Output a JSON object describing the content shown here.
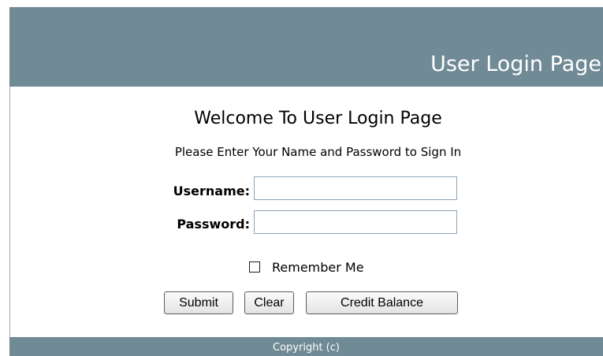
{
  "header": {
    "title": "User Login Page"
  },
  "main": {
    "welcome_heading": "Welcome To User Login Page",
    "instructions": "Please Enter Your Name and Password to Sign In",
    "username": {
      "label": "Username:",
      "value": ""
    },
    "password": {
      "label": "Password:",
      "value": ""
    },
    "remember_me": {
      "label": "Remember Me",
      "checked": false
    },
    "buttons": {
      "submit": "Submit",
      "clear": "Clear",
      "credit_balance": "Credit Balance"
    }
  },
  "footer": {
    "copyright": "Copyright (c)"
  },
  "colors": {
    "bar_background": "#708a96",
    "bar_text": "#ffffff",
    "input_border": "#8ea4bb"
  }
}
